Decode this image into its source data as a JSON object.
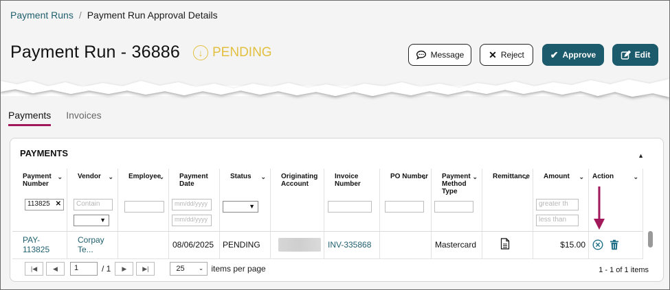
{
  "breadcrumb": {
    "parent": "Payment Runs",
    "separator": "/",
    "current": "Payment Run Approval Details"
  },
  "header": {
    "title": "Payment Run - 36886",
    "status": "PENDING",
    "buttons": {
      "message": "Message",
      "reject": "Reject",
      "approve": "Approve",
      "edit": "Edit"
    }
  },
  "tabs": [
    {
      "label": "Payments",
      "active": true
    },
    {
      "label": "Invoices",
      "active": false
    }
  ],
  "panel": {
    "title": "PAYMENTS"
  },
  "table": {
    "columns": [
      {
        "label": "Payment Number"
      },
      {
        "label": "Vendor"
      },
      {
        "label": "Employee"
      },
      {
        "label": "Payment Date"
      },
      {
        "label": "Status"
      },
      {
        "label": "Originating Account"
      },
      {
        "label": "Invoice Number"
      },
      {
        "label": "PO Number"
      },
      {
        "label": "Payment Method Type"
      },
      {
        "label": "Remittance"
      },
      {
        "label": "Amount"
      },
      {
        "label": "Action"
      }
    ],
    "filters": {
      "payment_number": "113825",
      "vendor_placeholder": "Contain",
      "date_placeholder_1": "mm/dd/yyyy",
      "date_placeholder_2": "mm/dd/yyyy",
      "amount_placeholder_1": "greater th",
      "amount_placeholder_2": "less than"
    },
    "rows": [
      {
        "payment_number": "PAY-113825",
        "vendor": "Corpay Te...",
        "employee": "",
        "payment_date": "08/06/2025",
        "status": "PENDING",
        "invoice_number": "INV-335868",
        "po_number": "",
        "payment_method": "Mastercard",
        "amount": "$15.00"
      }
    ]
  },
  "pager": {
    "page": "1",
    "total": "/ 1",
    "per_page": "25",
    "per_page_label": "items per page",
    "count": "1 - 1 of 1 items"
  },
  "colors": {
    "accent": "#1c5b6b",
    "link": "#1f5f6d",
    "pending": "#e3bf3f",
    "tab_underline": "#a0175a",
    "arrow": "#a0175a"
  },
  "icons": {
    "status": "arrow-down-circle-icon",
    "message": "speech-bubble-icon",
    "reject": "x-icon",
    "approve": "check-icon",
    "edit": "edit-icon",
    "remittance": "document-icon",
    "cancel": "cancel-circle-icon",
    "delete": "trash-icon"
  }
}
